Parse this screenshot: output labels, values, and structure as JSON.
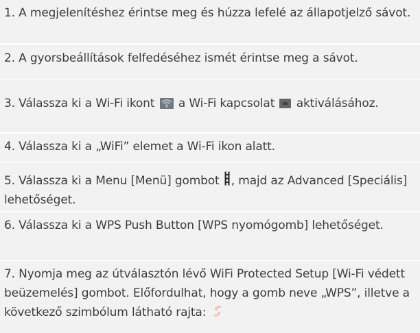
{
  "steps": [
    {
      "pre": "1. A megjelenítéshez érintse meg és húzza lefelé az állapotjelző sávot."
    },
    {
      "pre": "2. A gyorsbeállítások felfedéséhez ismét érintse meg a sávot."
    },
    {
      "pre": "3. Válassza ki a Wi-Fi ikont ",
      "mid": " a Wi-Fi kapcsolat ",
      "post": " aktiválásához."
    },
    {
      "pre": "4. Válassza ki a „WiFi” elemet a Wi-Fi ikon alatt."
    },
    {
      "pre": "5. Válassza ki a Menu [Menü] gombot ",
      "post": ", majd az Advanced [Speciális] lehetőséget."
    },
    {
      "pre": "6. Válassza ki a WPS Push Button [WPS nyomógomb] lehetőséget."
    },
    {
      "pre": "7. Nyomja meg az útválasztón lévő WiFi Protected Setup [Wi-Fi védett beüzemelés] gombot. Előfordulhat, hogy a gomb neve „WPS”, illetve a következő szimbólum látható rajta: "
    }
  ],
  "icons": {
    "wifi": "wifi-icon",
    "connection": "wifi-connection-toggle-icon",
    "menu": "menu-button-icon",
    "wps": "wps-symbol-icon"
  },
  "colors": {
    "background": "#f2f2f2",
    "divider": "#ffffff",
    "text": "#3d3d3d",
    "wps_symbol": "#f0c6b8"
  }
}
